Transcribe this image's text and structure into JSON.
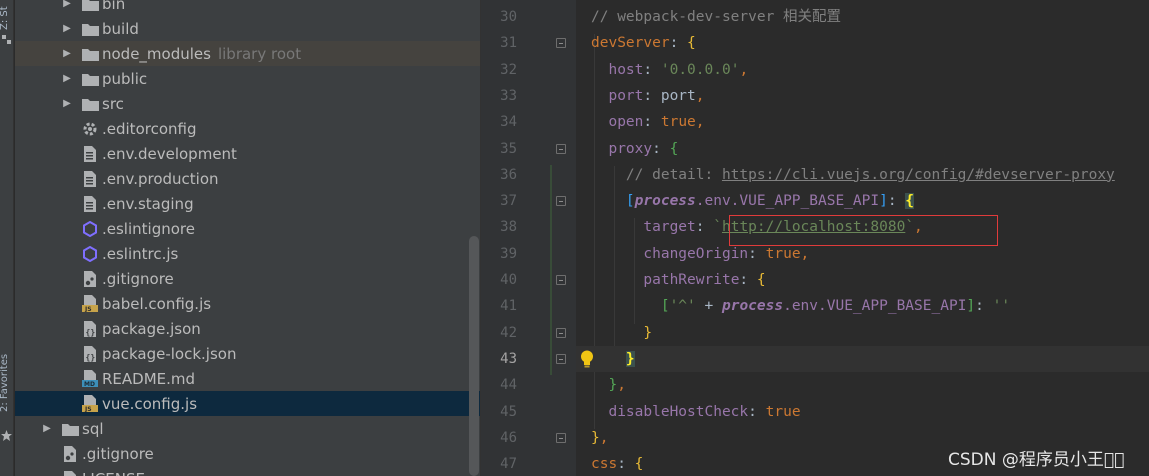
{
  "toolstrip": {
    "top_label": "Z: St",
    "bottom_label": "2: Favorites"
  },
  "tree": {
    "items": [
      {
        "label": "bin",
        "type": "folder",
        "arrow": "▶",
        "indent": 1
      },
      {
        "label": "build",
        "type": "folder",
        "arrow": "▶",
        "indent": 1
      },
      {
        "label": "node_modules",
        "type": "folder",
        "arrow": "▶",
        "indent": 1,
        "hint": "library root"
      },
      {
        "label": "public",
        "type": "folder",
        "arrow": "▶",
        "indent": 1
      },
      {
        "label": "src",
        "type": "folder",
        "arrow": "▶",
        "indent": 1
      },
      {
        "label": ".editorconfig",
        "type": "gear",
        "indent": 1
      },
      {
        "label": ".env.development",
        "type": "file",
        "indent": 1
      },
      {
        "label": ".env.production",
        "type": "file",
        "indent": 1
      },
      {
        "label": ".env.staging",
        "type": "file",
        "indent": 1
      },
      {
        "label": ".eslintignore",
        "type": "eslint",
        "indent": 1
      },
      {
        "label": ".eslintrc.js",
        "type": "eslint",
        "indent": 1
      },
      {
        "label": ".gitignore",
        "type": "git",
        "indent": 1
      },
      {
        "label": "babel.config.js",
        "type": "js",
        "indent": 1
      },
      {
        "label": "package.json",
        "type": "json",
        "indent": 1
      },
      {
        "label": "package-lock.json",
        "type": "json",
        "indent": 1
      },
      {
        "label": "README.md",
        "type": "md",
        "indent": 1
      },
      {
        "label": "vue.config.js",
        "type": "js",
        "indent": 1,
        "selected": true
      },
      {
        "label": "sql",
        "type": "folder",
        "arrow": "▶",
        "indent": 0
      },
      {
        "label": ".gitignore",
        "type": "git",
        "indent": 0
      },
      {
        "label": "LICENSE",
        "type": "file",
        "indent": 0
      }
    ]
  },
  "editor": {
    "line_numbers": [
      "30",
      "31",
      "32",
      "33",
      "34",
      "35",
      "36",
      "37",
      "38",
      "39",
      "40",
      "41",
      "42",
      "43",
      "44",
      "45",
      "46",
      "47"
    ],
    "current_line": "43",
    "lines": {
      "l30": "// webpack-dev-server 相关配置",
      "l31a": "devServer",
      "l31b": ": ",
      "l31c": "{",
      "l32a": "host",
      "l32b": ": ",
      "l32c": "'0.0.0.0'",
      "l32d": ",",
      "l33a": "port",
      "l33b": ": port",
      "l33c": ",",
      "l34a": "open",
      "l34b": ": ",
      "l34c": "true",
      "l34d": ",",
      "l35a": "proxy",
      "l35b": ": ",
      "l35c": "{",
      "l36a": "// detail: ",
      "l36b": "https://cli.vuejs.org/config/#devserver-proxy",
      "l37a": "[",
      "l37b": "process",
      "l37c": ".env.VUE_APP_BASE_API",
      "l37d": "]",
      "l37e": ": ",
      "l37f": "{",
      "l38a": "target",
      "l38b": ": ",
      "l38c": "`",
      "l38d": "http://localhost:8080",
      "l38e": "`",
      "l38f": ",",
      "l39a": "changeOrigin",
      "l39b": ": ",
      "l39c": "true",
      "l39d": ",",
      "l40a": "pathRewrite",
      "l40b": ": ",
      "l40c": "{",
      "l41a": "[",
      "l41b": "'^'",
      "l41c": " + ",
      "l41d": "process",
      "l41e": ".env.VUE_APP_BASE_API",
      "l41f": "]",
      "l41g": ": ",
      "l41h": "''",
      "l42": "}",
      "l43": "}",
      "l44a": "}",
      "l44b": ",",
      "l45a": "disableHostCheck",
      "l45b": ": ",
      "l45c": "true",
      "l46a": "}",
      "l46b": ",",
      "l47a": "css",
      "l47b": ": ",
      "l47c": "{"
    }
  },
  "watermark": "CSDN @程序员小王\u0000\u0000",
  "colors": {
    "accent_box": "#e03b3b",
    "selection": "#0d293e"
  }
}
